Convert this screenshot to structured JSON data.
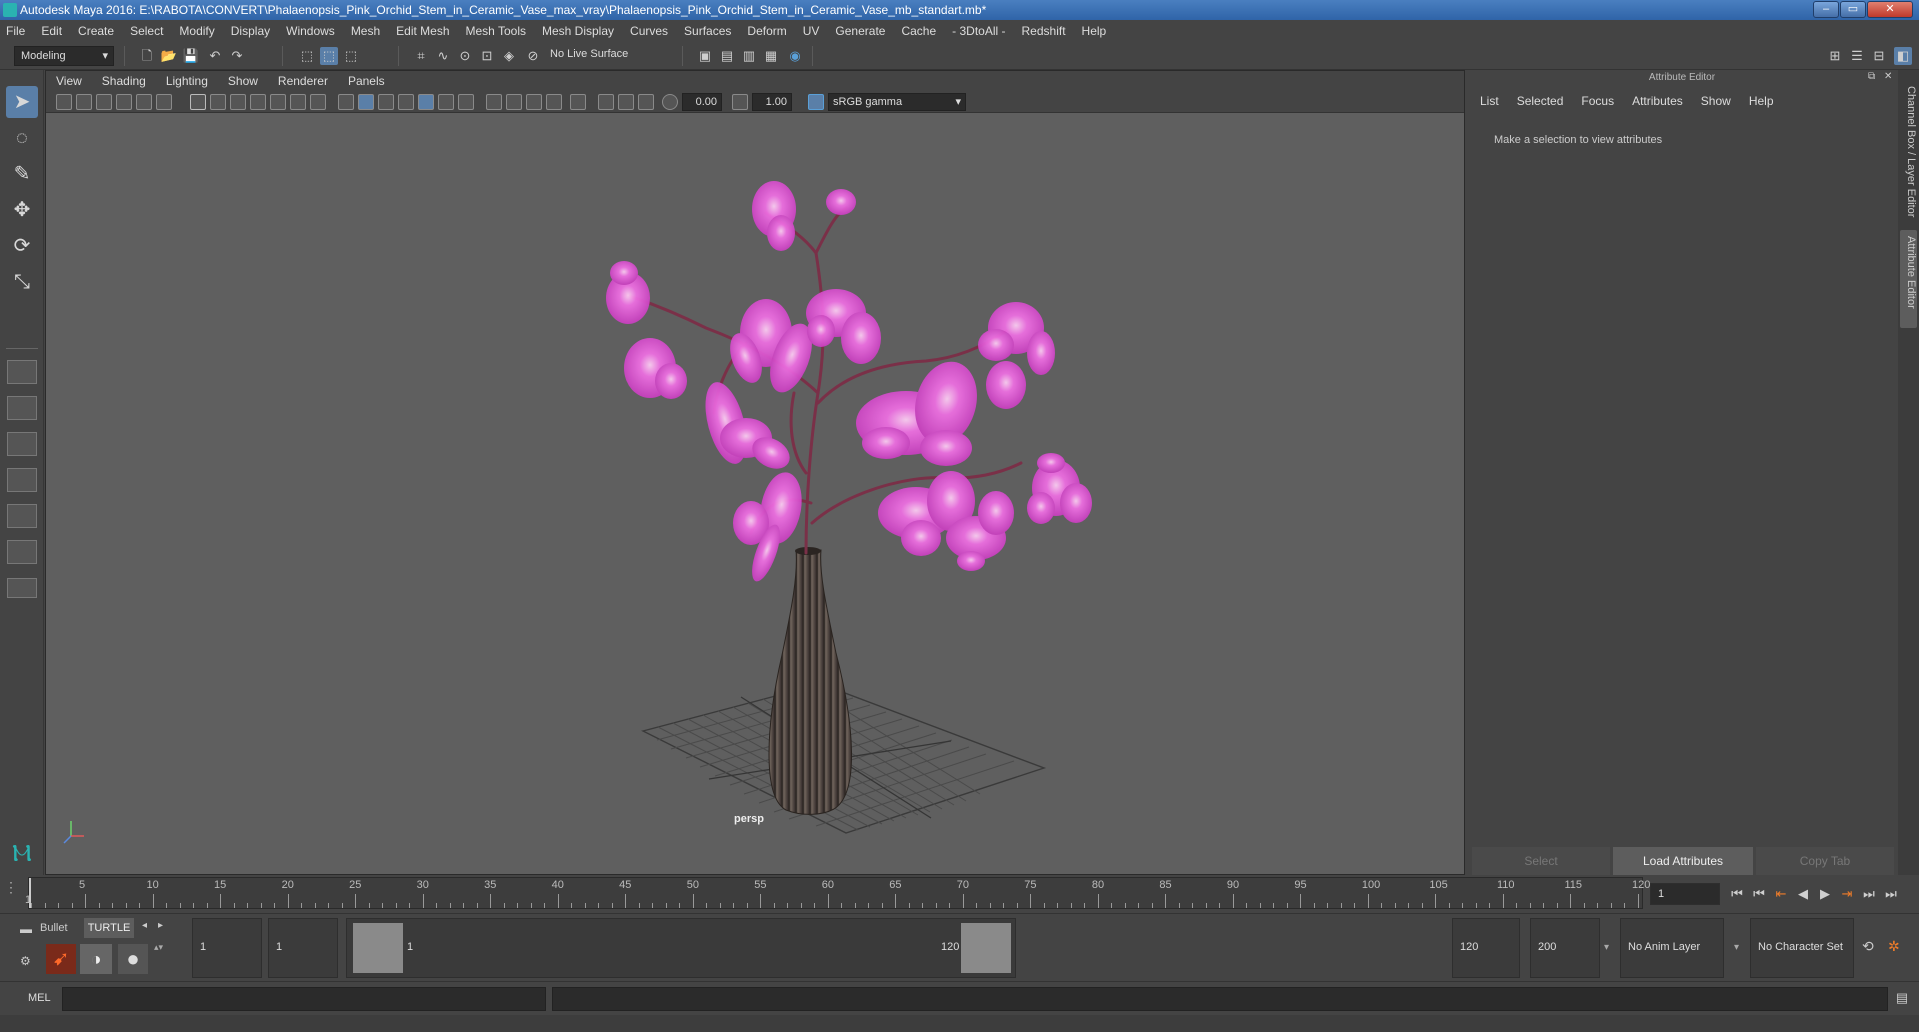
{
  "window": {
    "title": "Autodesk Maya 2016: E:\\RABOTA\\CONVERT\\Phalaenopsis_Pink_Orchid_Stem_in_Ceramic_Vase_max_vray\\Phalaenopsis_Pink_Orchid_Stem_in_Ceramic_Vase_mb_standart.mb*",
    "minimize": "–",
    "maximize": "▭",
    "close": "✕"
  },
  "menu": [
    "File",
    "Edit",
    "Create",
    "Select",
    "Modify",
    "Display",
    "Windows",
    "Mesh",
    "Edit Mesh",
    "Mesh Tools",
    "Mesh Display",
    "Curves",
    "Surfaces",
    "Deform",
    "UV",
    "Generate",
    "Cache",
    "- 3DtoAll -",
    "Redshift",
    "Help"
  ],
  "shelf": {
    "mode": "Modeling",
    "live_surface": "No Live Surface"
  },
  "viewport": {
    "menu": [
      "View",
      "Shading",
      "Lighting",
      "Show",
      "Renderer",
      "Panels"
    ],
    "exposure": "0.00",
    "gamma": "1.00",
    "color_space": "sRGB gamma",
    "camera": "persp"
  },
  "attribute_editor": {
    "title": "Attribute Editor",
    "menu": [
      "List",
      "Selected",
      "Focus",
      "Attributes",
      "Show",
      "Help"
    ],
    "message": "Make a selection to view attributes",
    "buttons": {
      "select": "Select",
      "load": "Load Attributes",
      "copy": "Copy Tab"
    }
  },
  "side_tabs": {
    "channel": "Channel Box / Layer Editor",
    "attr": "Attribute Editor"
  },
  "timeline": {
    "current_frame": "1",
    "ticks": [
      "5",
      "10",
      "15",
      "20",
      "25",
      "30",
      "35",
      "40",
      "45",
      "50",
      "55",
      "60",
      "65",
      "70",
      "75",
      "80",
      "85",
      "90",
      "95",
      "100",
      "105",
      "110",
      "115",
      "120"
    ],
    "start_label": "1"
  },
  "range": {
    "start": "1",
    "anim_start": "1",
    "slider_start": "1",
    "slider_end": "120",
    "end": "120",
    "anim_end": "200",
    "anim_layer": "No Anim Layer",
    "char_set": "No Character Set",
    "tab_bullet": "Bullet",
    "tab_turtle": "TURTLE"
  },
  "cmd": {
    "label": "MEL"
  },
  "colors": {
    "accent": "#5aa0d8",
    "orchid": "#e44fd6",
    "vase": "#5a4d45"
  }
}
